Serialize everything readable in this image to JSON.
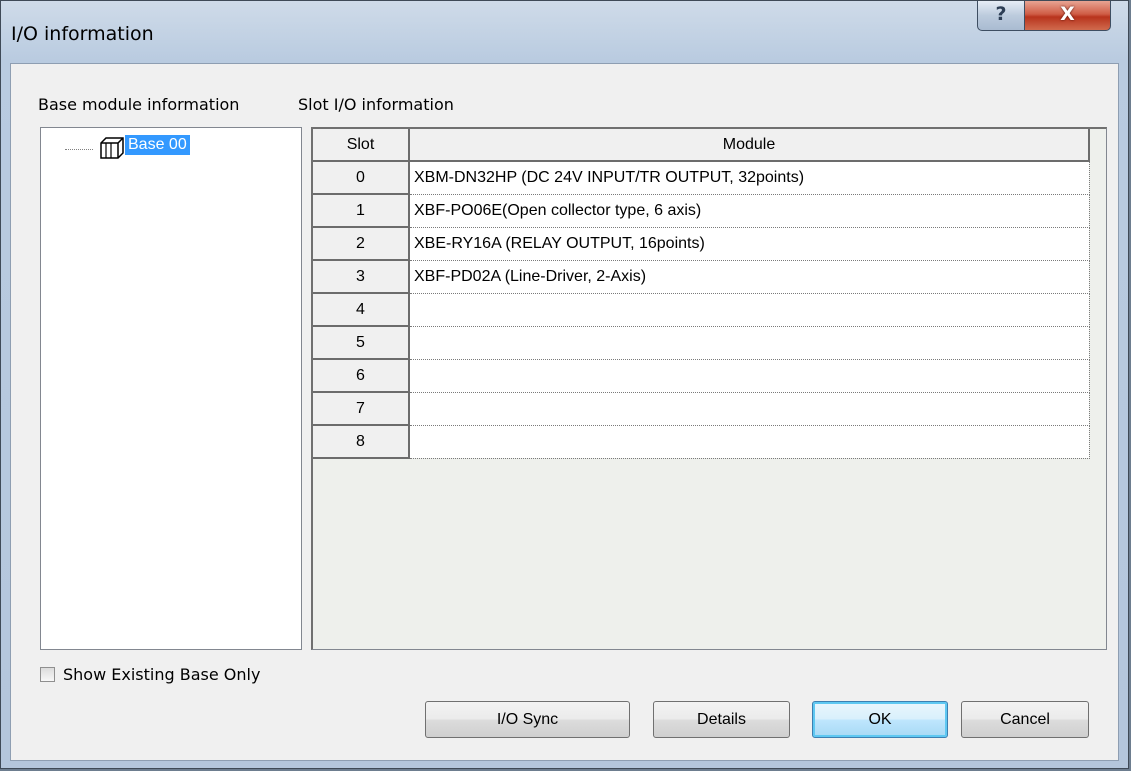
{
  "window": {
    "title": "I/O information",
    "help_glyph": "?",
    "close_glyph": "X"
  },
  "base_panel": {
    "label": "Base module information",
    "tree_node_label": "Base 00",
    "tree_node_icon": "base-module-icon"
  },
  "slot_panel": {
    "label": "Slot I/O information",
    "columns": [
      "Slot",
      "Module"
    ],
    "rows": [
      {
        "slot": "0",
        "module": "XBM-DN32HP (DC 24V INPUT/TR OUTPUT, 32points)"
      },
      {
        "slot": "1",
        "module": "XBF-PO06E(Open collector type, 6 axis)"
      },
      {
        "slot": "2",
        "module": "XBE-RY16A (RELAY OUTPUT, 16points)"
      },
      {
        "slot": "3",
        "module": "XBF-PD02A (Line-Driver, 2-Axis)"
      },
      {
        "slot": "4",
        "module": ""
      },
      {
        "slot": "5",
        "module": ""
      },
      {
        "slot": "6",
        "module": ""
      },
      {
        "slot": "7",
        "module": ""
      },
      {
        "slot": "8",
        "module": ""
      }
    ]
  },
  "show_existing": {
    "label": "Show Existing Base Only",
    "checked": false
  },
  "buttons": {
    "io_sync": "I/O Sync",
    "details": "Details",
    "ok": "OK",
    "cancel": "Cancel"
  },
  "colors": {
    "selection": "#3399ff",
    "close_button": "#c9422c",
    "default_button_border": "#3c7fb1"
  }
}
